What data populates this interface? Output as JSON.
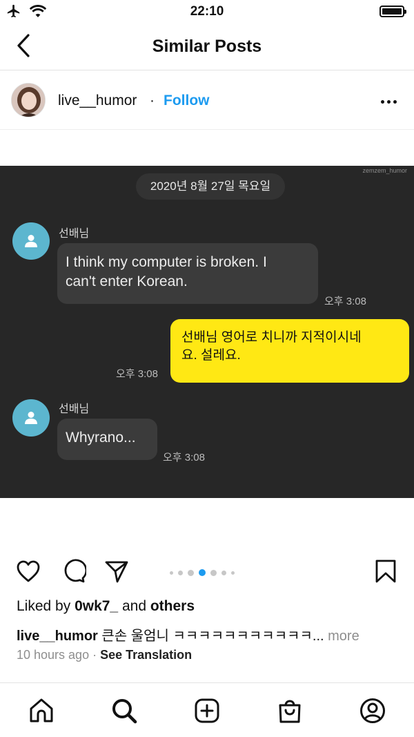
{
  "status_bar": {
    "time": "22:10"
  },
  "nav": {
    "title": "Similar Posts"
  },
  "post": {
    "username": "live__humor",
    "separator": "·",
    "follow_label": "Follow"
  },
  "media": {
    "watermark": "zemzem_humor",
    "date": "2020년 8월 27일 목요일",
    "messages": [
      {
        "sender": "선배님",
        "text_lines": [
          "I think my computer is broken. I",
          "can't enter Korean."
        ],
        "time": "오후 3:08"
      },
      {
        "text_lines": [
          "선배님 영어로 치니까 지적이시네",
          "요. 설레요."
        ],
        "time": "오후 3:08"
      },
      {
        "sender": "선배님",
        "text_lines": [
          "Whyrano..."
        ],
        "time": "오후 3:08"
      }
    ],
    "carousel": {
      "count": 7,
      "active": 3
    }
  },
  "likes": {
    "prefix": "Liked by ",
    "user": "0wk7_",
    "and": " and ",
    "others": "others"
  },
  "caption": {
    "username": "live__humor",
    "text": " 큰손 울엄니 ㅋㅋㅋㅋㅋㅋㅋㅋㅋㅋㅋ...",
    "more": " more"
  },
  "meta": {
    "time_ago": "10 hours ago",
    "separator": " · ",
    "see_translation": "See Translation"
  },
  "colors": {
    "follow_blue": "#1d9bf0",
    "chat_bg": "#272727",
    "bubble_out": "#ffe814",
    "chat_avatar": "#5cb6cf"
  },
  "icons": {
    "status": [
      "airplane-icon",
      "wifi-icon",
      "battery-icon"
    ],
    "actions": [
      "heart-icon",
      "comment-icon",
      "share-icon",
      "bookmark-icon"
    ],
    "tabs": [
      "home-icon",
      "search-icon",
      "create-icon",
      "shop-icon",
      "profile-icon"
    ]
  }
}
